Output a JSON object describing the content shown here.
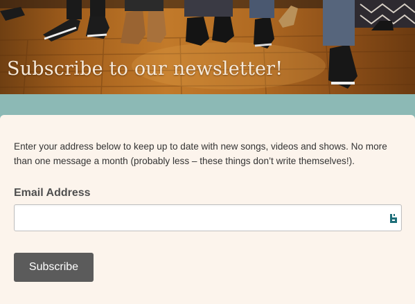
{
  "banner": {
    "title": "Subscribe to our newsletter!"
  },
  "form": {
    "intro": "Enter your address below to keep up to date with new songs, videos and shows.  No more than one message a month (probably less – these things don’t write themselves!).",
    "email_label": "Email Address",
    "email_value": "",
    "email_placeholder": "",
    "subscribe_label": "Subscribe"
  },
  "icons": {
    "autofill": "password-manager-autofill-icon"
  },
  "colors": {
    "page_teal": "#8cb9b5",
    "card_background": "#fcf4ec",
    "button_background": "#5b5b5b",
    "autofill_icon": "#1f6f7a"
  }
}
